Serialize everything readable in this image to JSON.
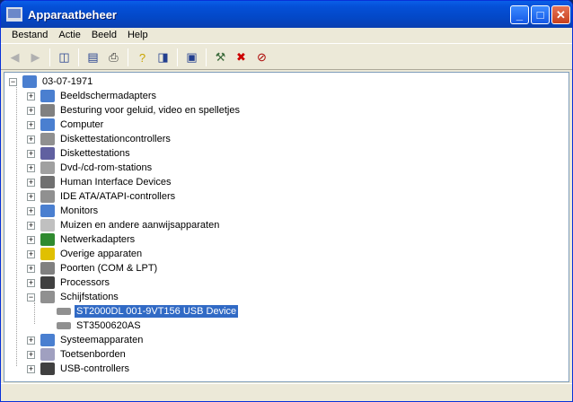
{
  "window": {
    "title": "Apparaatbeheer"
  },
  "menu": [
    "Bestand",
    "Actie",
    "Beeld",
    "Help"
  ],
  "tree": {
    "root": "03-07-1971",
    "items": [
      {
        "label": "Beeldschermadapters",
        "icon": "display-adapter-icon",
        "color": "#4a7fd0"
      },
      {
        "label": "Besturing voor geluid, video en spelletjes",
        "icon": "sound-icon",
        "color": "#808080"
      },
      {
        "label": "Computer",
        "icon": "computer-icon",
        "color": "#4a7fd0"
      },
      {
        "label": "Diskettestationcontrollers",
        "icon": "controller-icon",
        "color": "#909090"
      },
      {
        "label": "Diskettestations",
        "icon": "floppy-icon",
        "color": "#6060a0"
      },
      {
        "label": "Dvd-/cd-rom-stations",
        "icon": "cdrom-icon",
        "color": "#a0a0a0"
      },
      {
        "label": "Human Interface Devices",
        "icon": "hid-icon",
        "color": "#707070"
      },
      {
        "label": "IDE ATA/ATAPI-controllers",
        "icon": "ide-icon",
        "color": "#909090"
      },
      {
        "label": "Monitors",
        "icon": "monitor-icon",
        "color": "#4a7fd0"
      },
      {
        "label": "Muizen en andere aanwijsapparaten",
        "icon": "mouse-icon",
        "color": "#c0c0c0"
      },
      {
        "label": "Netwerkadapters",
        "icon": "network-icon",
        "color": "#2f8a2f"
      },
      {
        "label": "Overige apparaten",
        "icon": "question-icon",
        "color": "#e0c000"
      },
      {
        "label": "Poorten (COM & LPT)",
        "icon": "port-icon",
        "color": "#808080"
      },
      {
        "label": "Processors",
        "icon": "processor-icon",
        "color": "#404040"
      },
      {
        "label": "Schijfstations",
        "icon": "disk-drive-icon",
        "color": "#909090",
        "expanded": true,
        "children": [
          "ST2000DL 001-9VT156 USB Device",
          "ST3500620AS"
        ]
      },
      {
        "label": "Systeemapparaten",
        "icon": "system-icon",
        "color": "#4a7fd0"
      },
      {
        "label": "Toetsenborden",
        "icon": "keyboard-icon",
        "color": "#a0a0c0"
      },
      {
        "label": "USB-controllers",
        "icon": "usb-icon",
        "color": "#404040"
      }
    ]
  }
}
